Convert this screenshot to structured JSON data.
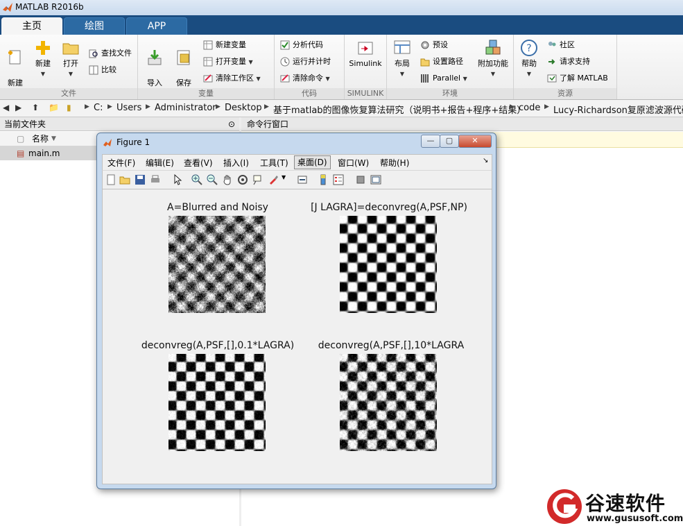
{
  "app": {
    "title": "MATLAB R2016b"
  },
  "tabs": [
    "主页",
    "绘图",
    "APP"
  ],
  "ribbon": {
    "file": {
      "label": "文件",
      "new_script": "新建\n脚本",
      "new": "新建",
      "open": "打开",
      "find_files": "查找文件",
      "compare": "比较"
    },
    "variable": {
      "label": "变量",
      "import": "导入\n数据",
      "save_ws": "保存\n工作区",
      "new_var": "新建变量",
      "open_var": "打开变量",
      "clear_ws": "清除工作区"
    },
    "code": {
      "label": "代码",
      "analyze": "分析代码",
      "run_time": "运行并计时",
      "clear_cmd": "清除命令"
    },
    "simulink": {
      "label": "SIMULINK",
      "simulink": "Simulink"
    },
    "env": {
      "label": "环境",
      "layout": "布局",
      "prefs": "预设",
      "set_path": "设置路径",
      "parallel": "Parallel",
      "addons": "附加功能"
    },
    "resources": {
      "label": "资源",
      "help": "帮助",
      "community": "社区",
      "support": "请求支持",
      "learn": "了解 MATLAB"
    }
  },
  "address": {
    "crumbs": [
      "C:",
      "Users",
      "Administrator",
      "Desktop",
      "基于matlab的图像恢复算法研究（说明书+报告+程序+结果）",
      "code",
      "Lucy-Richardson复原滤波源代码"
    ]
  },
  "left_panel": {
    "header": "当前文件夹",
    "col_name": "名称",
    "files": [
      "main.m"
    ]
  },
  "command_window": {
    "header": "命令行窗口"
  },
  "figure": {
    "title": "Figure 1",
    "menus": [
      "文件(F)",
      "编辑(E)",
      "查看(V)",
      "插入(I)",
      "工具(T)",
      "桌面(D)",
      "窗口(W)",
      "帮助(H)"
    ],
    "active_menu": "桌面(D)",
    "plots": [
      {
        "title": "A=Blurred and Noisy"
      },
      {
        "title": "[J LAGRA]=deconvreg(A,PSF,NP)"
      },
      {
        "title": "deconvreg(A,PSF,[],0.1*LAGRA)"
      },
      {
        "title": "deconvreg(A,PSF,[],10*LAGRA"
      }
    ]
  },
  "watermark": {
    "brand": "谷速软件",
    "url": "www.gususoft.com"
  },
  "colors": {
    "tabstrip": "#1a4c80",
    "tab_active": "#f5f5f5",
    "brand_red": "#d22a2a"
  }
}
